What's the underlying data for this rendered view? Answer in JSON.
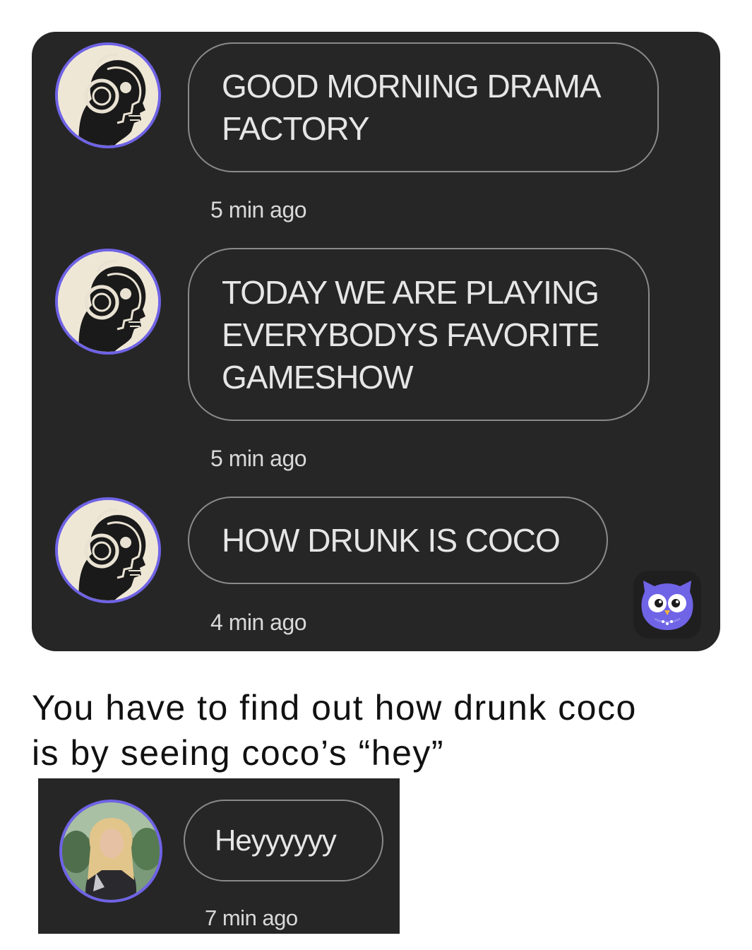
{
  "chat": {
    "messages": [
      {
        "text_lines": [
          "GOOD MORNING DRAMA",
          "FACTORY"
        ],
        "time": "5 min ago"
      },
      {
        "text_lines": [
          "TODAY WE ARE PLAYING",
          "EVERYBODYS FAVORITE",
          "GAMESHOW"
        ],
        "time": "5 min ago"
      },
      {
        "text_lines": [
          "HOW DRUNK IS COCO"
        ],
        "time": "4 min ago"
      }
    ],
    "avatar_icon": "skull-headphones-avatar",
    "app_icon": "owl-icon",
    "accent_color": "#6f63e6",
    "panel_color": "#262626"
  },
  "caption": {
    "line1": "You have to find out how drunk coco",
    "line2": "is by seeing coco’s “hey”"
  },
  "reply": {
    "text": "Heyyyyyy",
    "time": "7 min ago",
    "avatar_icon": "profile-photo-avatar"
  }
}
